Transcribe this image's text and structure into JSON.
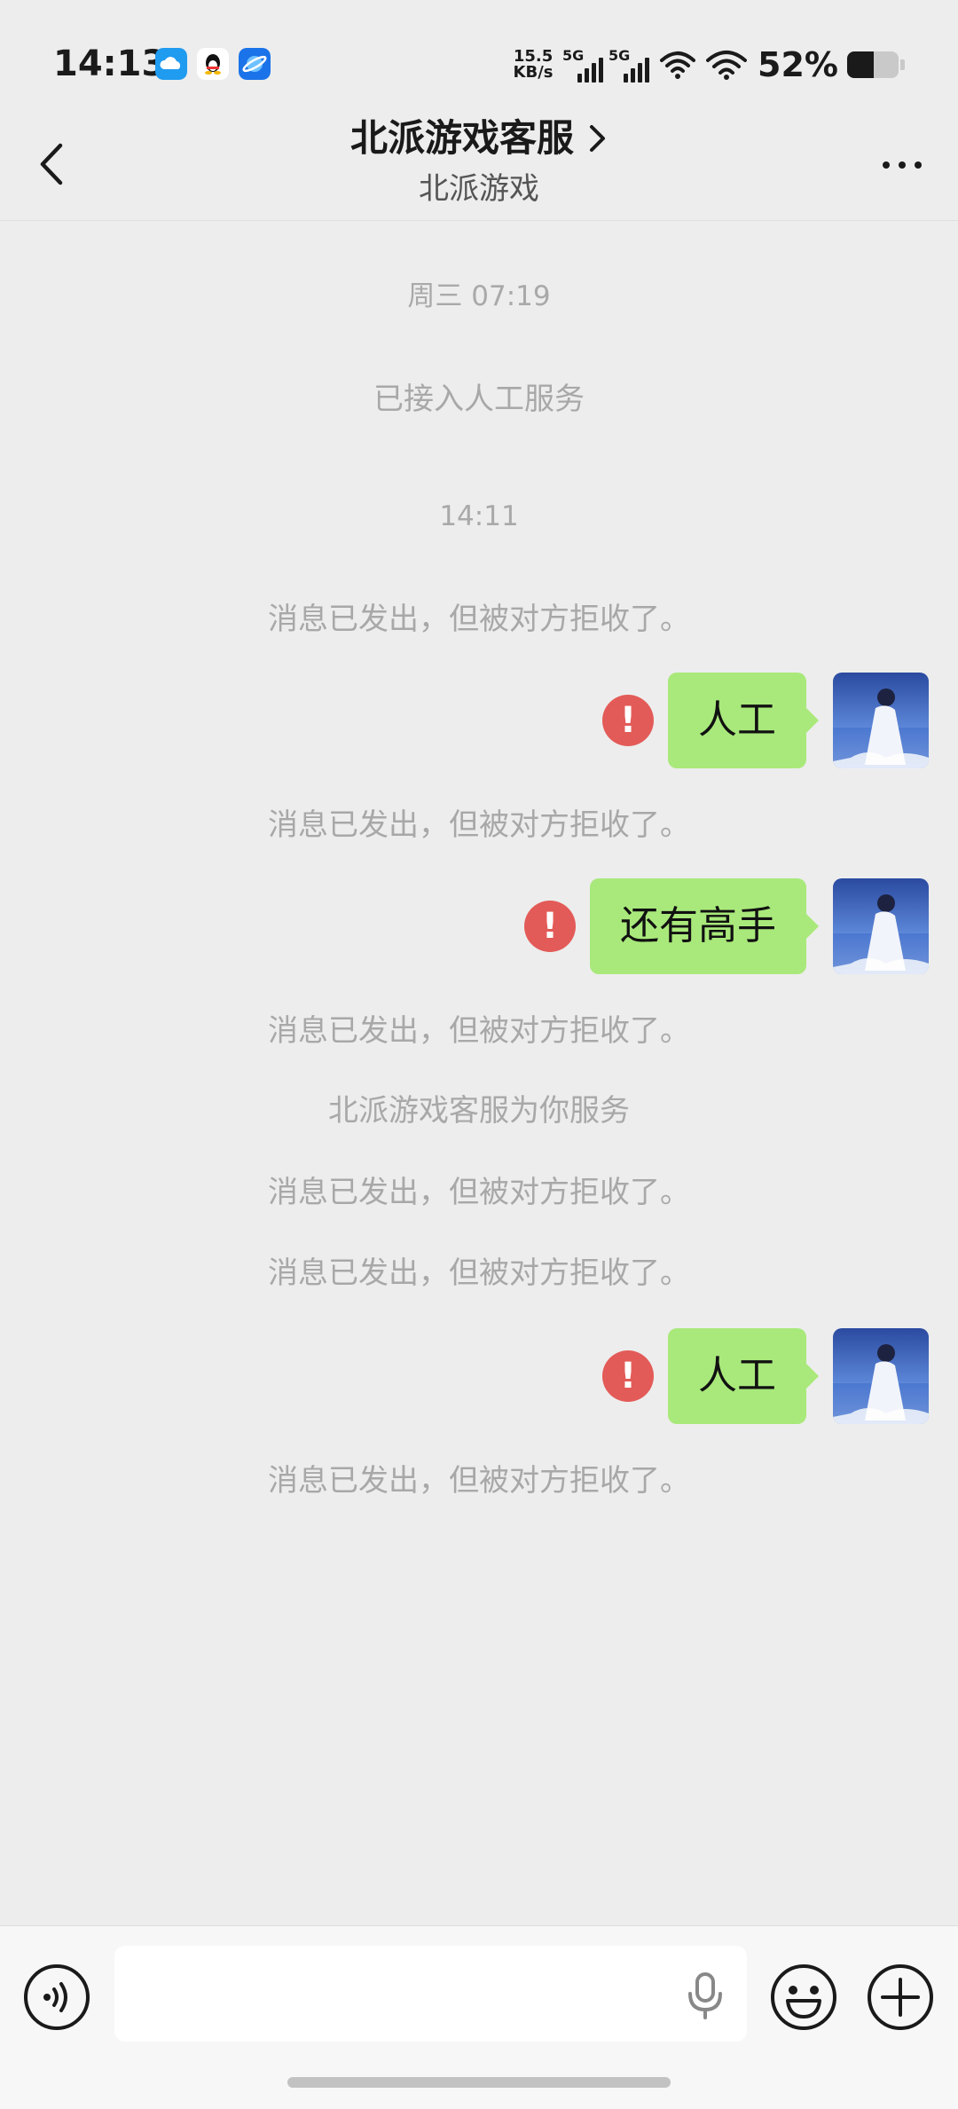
{
  "status_bar": {
    "time": "14:13",
    "net_speed_value": "15.5",
    "net_speed_unit": "KB/s",
    "signal1_tag": "5G",
    "signal2_tag": "5G",
    "battery_percent": "52%",
    "battery_level": 0.52,
    "app_icons": [
      "cloud-app-icon",
      "qq-penguin-icon",
      "browser-app-icon"
    ]
  },
  "header": {
    "title": "北派游戏客服",
    "subtitle": "北派游戏"
  },
  "chat": {
    "system_messages": [
      "周三 07:19",
      "已接入人工服务",
      "14:11",
      "消息已发出，但被对方拒收了。",
      "消息已发出，但被对方拒收了。",
      "消息已发出，但被对方拒收了。",
      "北派游戏客服为你服务",
      "消息已发出，但被对方拒收了。",
      "消息已发出，但被对方拒收了。",
      "消息已发出，但被对方拒收了。"
    ],
    "sent_messages": [
      {
        "text": "人工",
        "failed": true
      },
      {
        "text": "还有高手",
        "failed": true
      },
      {
        "text": "人工",
        "failed": true
      }
    ],
    "error_mark": "!"
  },
  "input": {
    "value": "",
    "placeholder": ""
  },
  "colors": {
    "background": "#ededed",
    "bubble_sent": "#a9e97b",
    "error": "#e35b58",
    "system_text": "#a8a8a8"
  }
}
